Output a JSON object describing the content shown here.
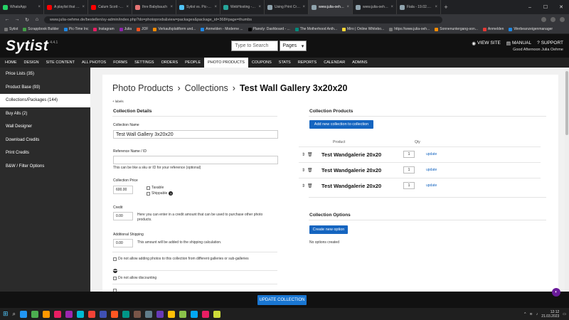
{
  "browser": {
    "tabs": [
      {
        "label": "WhatsApp",
        "color": "#25d366",
        "active": false
      },
      {
        "label": "A playlist that maki...",
        "color": "#ff0000",
        "active": false
      },
      {
        "label": "Calum Scott - If Ou...",
        "color": "#ff0000",
        "active": false
      },
      {
        "label": "Ihre Babybauch",
        "color": "#e57373",
        "active": false
      },
      {
        "label": "Sytist vs. Pic-Time",
        "color": "#4fc3f7",
        "active": false
      },
      {
        "label": "WebHosting - Ecr...",
        "color": "#26a69a",
        "active": false
      },
      {
        "label": "Using Print Credit ...",
        "color": "#90a4ae",
        "active": false
      },
      {
        "label": "www.julia-oehme...",
        "color": "#90a4ae",
        "active": true
      },
      {
        "label": "www.julia-oehme...",
        "color": "#90a4ae",
        "active": false
      },
      {
        "label": "Fiala - 19.02.2023",
        "color": "#90a4ae",
        "active": false
      }
    ],
    "url": "www.julia-oehme.de/bestellen/sy-admin/index.php?do=photoprods&view=packages&package_id=368#page=thumbs",
    "bookmarks": [
      {
        "label": "Sytist",
        "color": "#777"
      },
      {
        "label": "Scrappbook Builder",
        "color": "#43a047"
      },
      {
        "label": "Pic-Time Inc",
        "color": "#1e88e5"
      },
      {
        "label": "Instagram",
        "color": "#e91e63"
      },
      {
        "label": "Julia",
        "color": "#8e24aa"
      },
      {
        "label": "JOF",
        "color": "#f4511e"
      },
      {
        "label": "Verkaufsplattform und...",
        "color": "#fb8c00"
      },
      {
        "label": "Anmelden - Moderne ...",
        "color": "#1e88e5"
      },
      {
        "label": "Planoly: Dashboard - ...",
        "color": "#000000"
      },
      {
        "label": "The Motherhood Anth...",
        "color": "#00897b"
      },
      {
        "label": "Miro | Online Whitebo...",
        "color": "#fdd835"
      },
      {
        "label": "https://www.julia-oeh...",
        "color": "#777"
      },
      {
        "label": "Sonnenuntergang-son...",
        "color": "#fb8c00"
      },
      {
        "label": "Anmelden",
        "color": "#e53935"
      },
      {
        "label": "Werbeanzeigenmanager",
        "color": "#1e88e5"
      }
    ]
  },
  "app": {
    "logo": "Sytist",
    "version": "4.4.1",
    "search_placeholder": "Type to Search",
    "page_select": "Pages",
    "view_site": "VIEW SITE",
    "manual": "MANUAL",
    "support": "SUPPORT",
    "greeting": "Good Afternoon Julia Oehme"
  },
  "nav": [
    "HOME",
    "DESIGN",
    "SITE CONTENT",
    "ALL PHOTOS",
    "FORMS",
    "SETTINGS",
    "ORDERS",
    "PEOPLE",
    "PHOTO PRODUCTS",
    "COUPONS",
    "STATS",
    "REPORTS",
    "CALENDAR",
    "ADMINS"
  ],
  "sidebar": [
    {
      "label": "Price Lists (35)"
    },
    {
      "label": "Product Base (93)"
    },
    {
      "label": "Collections/Packages (144)"
    },
    {
      "label": "Buy Alls (2)"
    },
    {
      "label": "Wall Designer"
    },
    {
      "label": "Download Credits"
    },
    {
      "label": "Print Credits"
    },
    {
      "label": "B&W / Filter Options"
    }
  ],
  "breadcrumb": {
    "part1": "Photo Products",
    "part2": "Collections",
    "current": "Test Wall Gallery 3x20x20",
    "sep": "›"
  },
  "labels_link": "+ labels",
  "details": {
    "heading": "Collection Details",
    "name_label": "Collection Name",
    "name_value": "Test Wall Gallery 3x20x20",
    "ref_label": "Reference Name / ID",
    "ref_value": "",
    "ref_help": "This can be like a sku or ID for your reference (optional)",
    "price_label": "Collection Price",
    "price_value": "600.00",
    "taxable": "Taxable",
    "shippable": "Shippable",
    "credit_label": "Credit",
    "credit_value": "0.00",
    "credit_help": "Here you can enter in a credit amount that can be used to purchase other photo products.",
    "shipping_label": "Additional Shipping",
    "shipping_value": "0.00",
    "shipping_help": "This amount will be added to the shipping calculation.",
    "cb_other_galleries": "Do not allow adding photos to this collection from different galleries or sub-galleries",
    "cb_discounting": "Do not allow discounting"
  },
  "products": {
    "heading": "Collection Products",
    "add_button": "Add new collection to collection",
    "col_product": "Product",
    "col_qty": "Qty",
    "rows": [
      {
        "name": "Test Wandgalerie 20x20",
        "qty": "1",
        "action": "update"
      },
      {
        "name": "Test Wandgalerie 20x20",
        "qty": "1",
        "action": "update"
      },
      {
        "name": "Test Wandgalerie 20x20",
        "qty": "1",
        "action": "update"
      }
    ]
  },
  "options": {
    "heading": "Collection Options",
    "create_button": "Create new option",
    "empty_text": "No options created"
  },
  "update_button": "UPDATE COLLECTION",
  "taskbar": {
    "time": "12:12",
    "date": "21.03.2023",
    "icons": [
      "#2196f3",
      "#4caf50",
      "#ff9800",
      "#e91e63",
      "#9c27b0",
      "#00bcd4",
      "#f44336",
      "#3f51b5",
      "#ff5722",
      "#009688",
      "#795548",
      "#607d8b",
      "#673ab7",
      "#ffc107",
      "#8bc34a",
      "#03a9f4",
      "#e91e63",
      "#cddc39"
    ]
  }
}
